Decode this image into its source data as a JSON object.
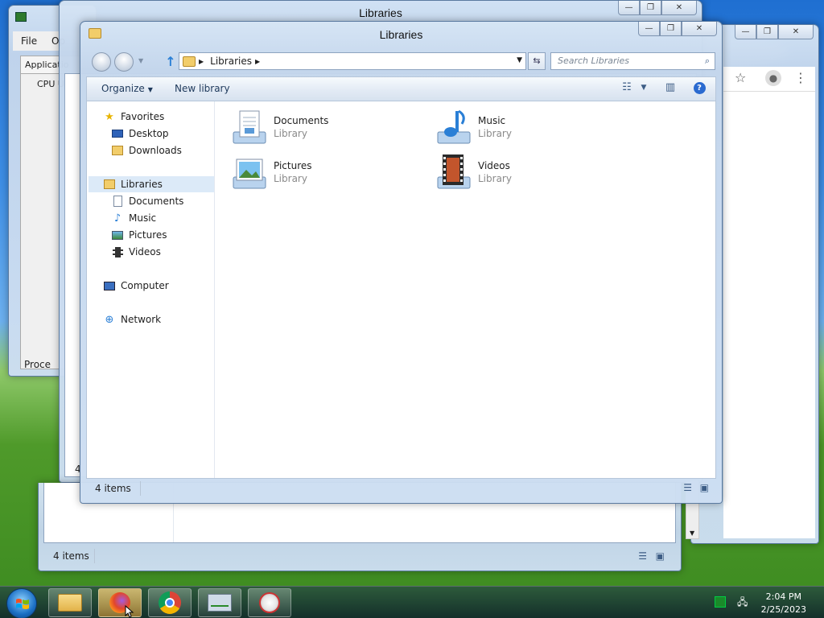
{
  "main_window": {
    "title": "Libraries",
    "address_crumb": "Libraries",
    "search_placeholder": "Search Libraries",
    "commands": {
      "organize": "Organize",
      "new_library": "New library"
    },
    "nav": {
      "favorites": "Favorites",
      "desktop": "Desktop",
      "downloads": "Downloads",
      "libraries": "Libraries",
      "documents": "Documents",
      "music": "Music",
      "pictures": "Pictures",
      "videos": "Videos",
      "computer": "Computer",
      "network": "Network"
    },
    "libraries": [
      {
        "name": "Documents",
        "type": "Library"
      },
      {
        "name": "Music",
        "type": "Library"
      },
      {
        "name": "Pictures",
        "type": "Library"
      },
      {
        "name": "Videos",
        "type": "Library"
      }
    ],
    "status": "4 items"
  },
  "back_window": {
    "title": "Libraries",
    "status": "4 items",
    "partial_status": "4"
  },
  "task_manager": {
    "menu_file": "File",
    "menu_options_partial": "Op",
    "tab_partial": "Applicatio",
    "cpu_partial": "CPU U",
    "processes_partial": "Proce"
  },
  "taskbar": {
    "time": "2:04 PM",
    "date": "2/25/2023"
  },
  "colors": {
    "accent": "#2a7fd6",
    "selected": "#dceaf8"
  }
}
